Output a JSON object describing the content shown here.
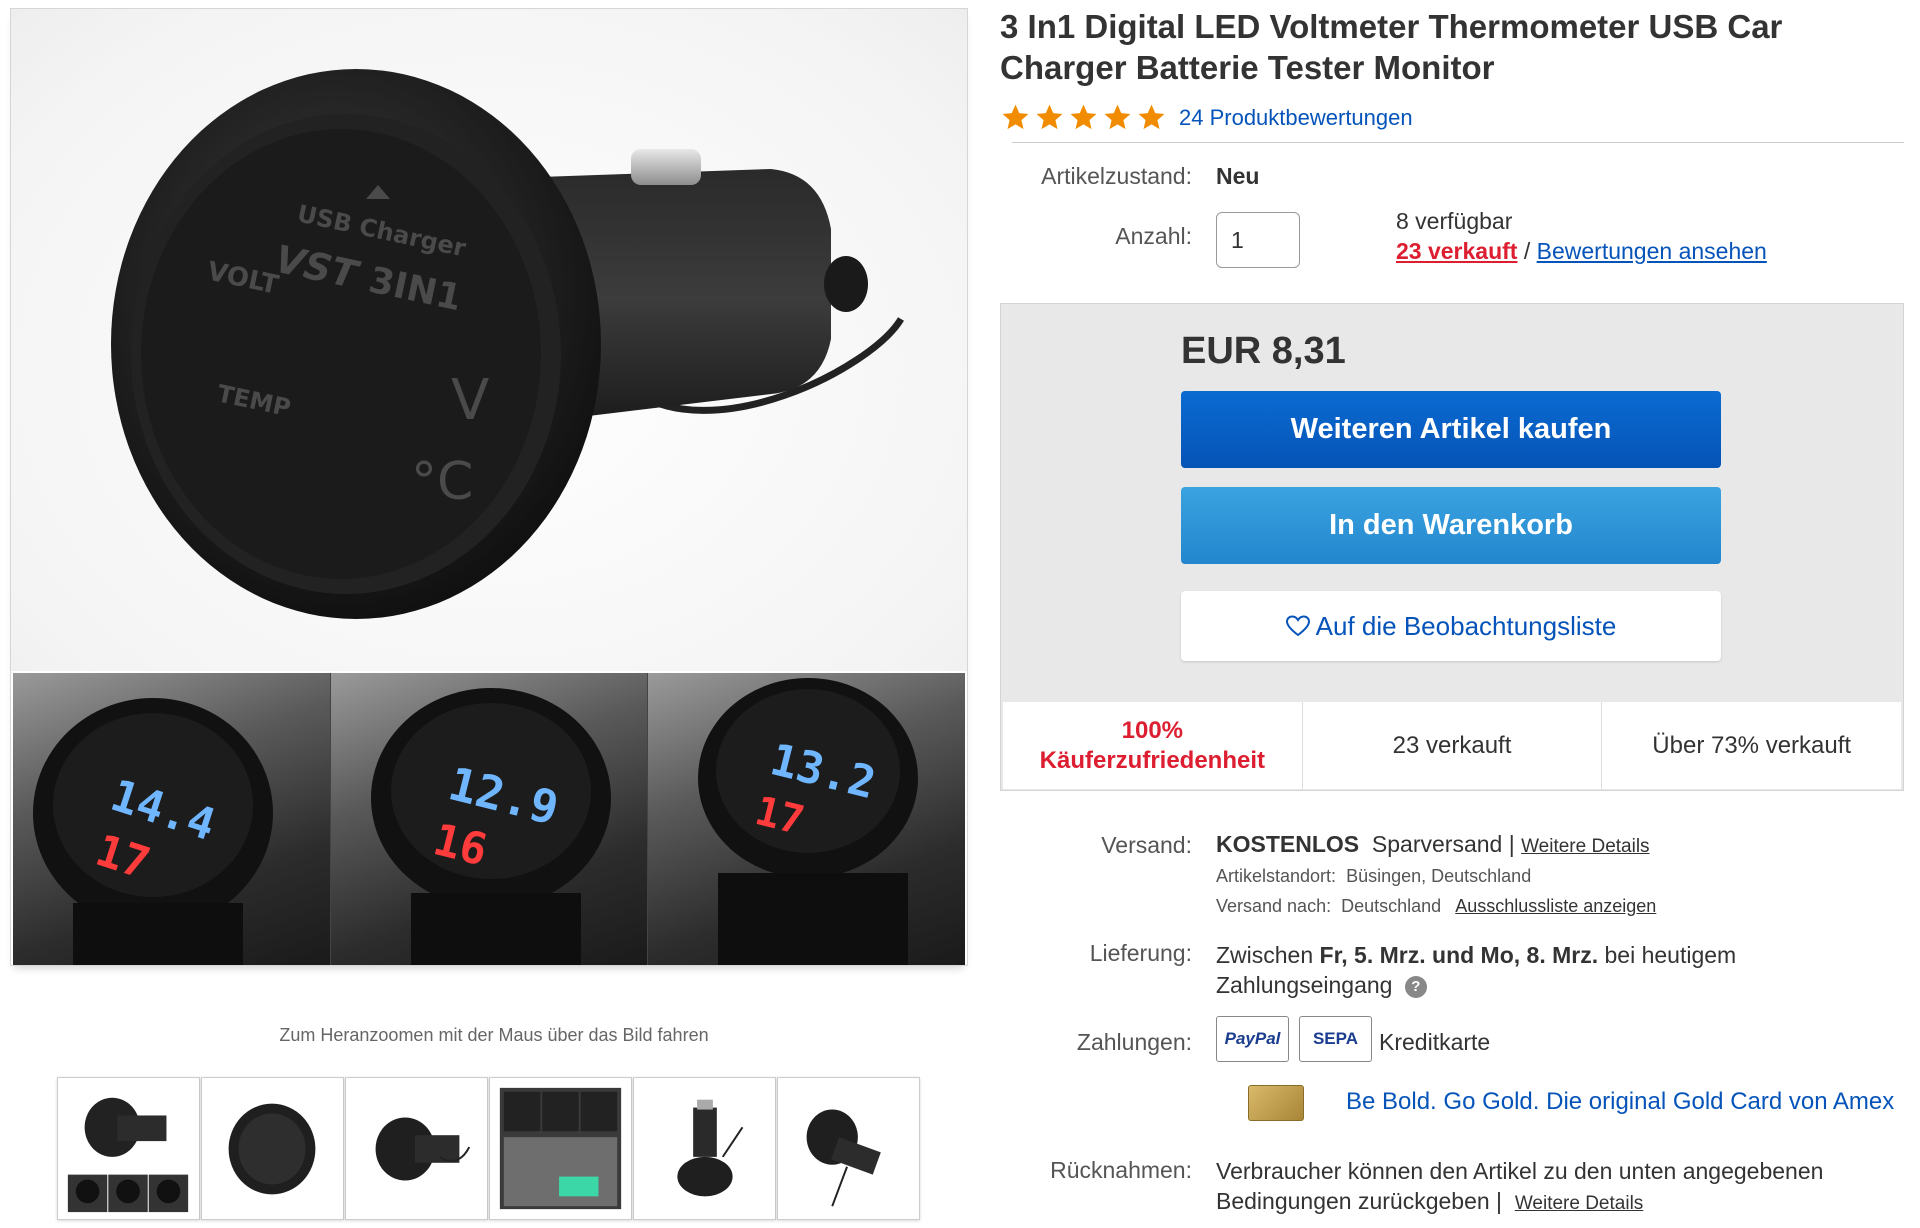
{
  "product": {
    "title": "3 In1 Digital LED Voltmeter Thermometer USB Car Charger Batterie Tester Monitor",
    "rating_stars": 5,
    "ratings_link": "24 Produktbewertungen"
  },
  "images": {
    "zoom_hint": "Zum Heranzoomen mit der Maus über das Bild fahren",
    "main_display": {
      "brand": "VST",
      "model": "3IN1",
      "usb_label": "USB Charger",
      "volt_label": "VOLT",
      "temp_label": "TEMP",
      "unit_v": "V",
      "unit_c": "°C"
    },
    "strip_readings": [
      {
        "volt": "14.4",
        "temp": "17"
      },
      {
        "volt": "12.9",
        "temp": "16"
      },
      {
        "volt": "13.2",
        "temp": "17"
      }
    ],
    "thumbnails": [
      "thumb-1",
      "thumb-2",
      "thumb-3",
      "thumb-4",
      "thumb-5",
      "thumb-6"
    ]
  },
  "details": {
    "condition_label": "Artikelzustand:",
    "condition_value": "Neu",
    "qty_label": "Anzahl:",
    "qty_value": "1",
    "available": "8 verfügbar",
    "sold_link": "23 verkauft",
    "separator": "/",
    "reviews_link": "Bewertungen ansehen"
  },
  "purchase": {
    "price": "EUR 8,31",
    "buy_button": "Weiteren Artikel kaufen",
    "cart_button": "In den Warenkorb",
    "watch_button": "Auf die Beobachtungsliste",
    "stats": {
      "satisfaction_1": "100%",
      "satisfaction_2": "Käuferzufriedenheit",
      "sold": "23 verkauft",
      "sold_percent": "Über 73% verkauft"
    }
  },
  "shipping": {
    "label": "Versand:",
    "cost": "KOSTENLOS",
    "method": "Sparversand |",
    "details_link": "Weitere Details",
    "location_label": "Artikelstandort:",
    "location_value": "Büsingen, Deutschland",
    "ships_to_label": "Versand nach:",
    "ships_to_value": "Deutschland",
    "exclusions_link": "Ausschlussliste anzeigen"
  },
  "delivery": {
    "label": "Lieferung:",
    "text_1": "Zwischen",
    "date_range": "Fr, 5. Mrz. und Mo, 8. Mrz.",
    "text_2": "bei heutigem",
    "text_3": "Zahlungseingang",
    "help_glyph": "?"
  },
  "payments": {
    "label": "Zahlungen:",
    "paypal": "PayPal",
    "sepa": "SEPA",
    "card": "Kreditkarte",
    "amex_promo": "Be Bold. Go Gold. Die original Gold Card von Amex"
  },
  "returns": {
    "label": "Rücknahmen:",
    "text_1": "Verbraucher können den Artikel zu den unten angegebenen",
    "text_2": "Bedingungen zurückgeben |",
    "details_link": "Weitere Details"
  },
  "colors": {
    "link": "#0654ba",
    "sold_red": "#dd1e31",
    "buy_blue": "#0653b6",
    "cart_blue": "#2386ce",
    "star": "#f18c00",
    "lcd_blue": "#6fb6ff",
    "lcd_red": "#ff3b3b"
  }
}
